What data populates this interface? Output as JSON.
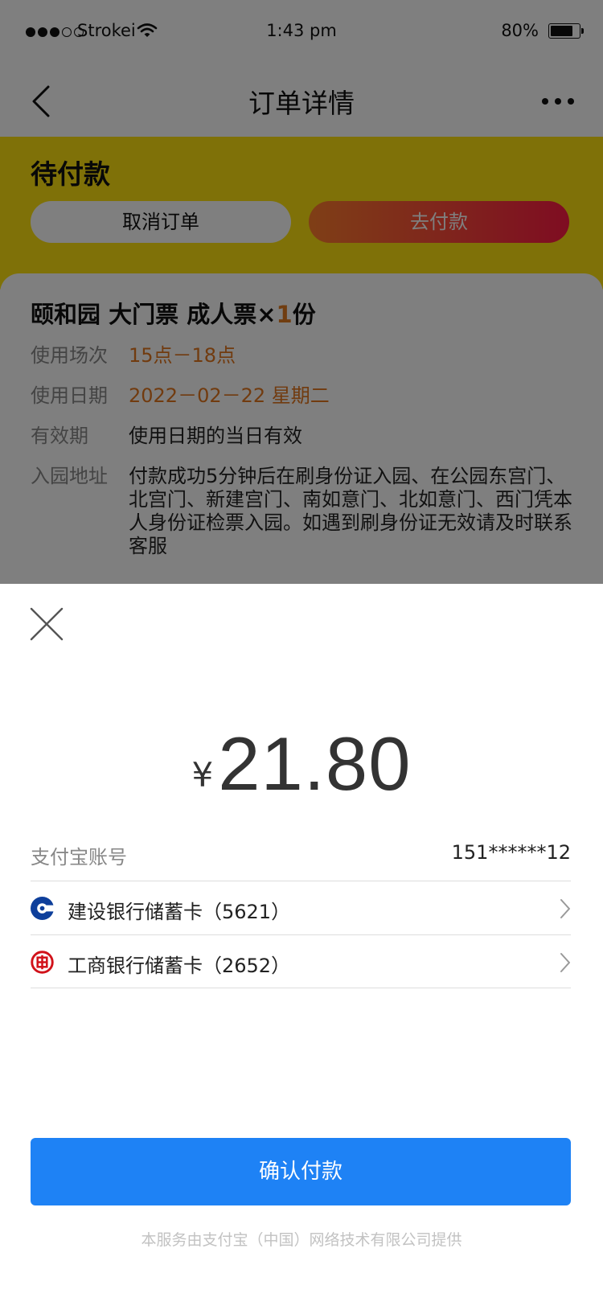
{
  "status_bar": {
    "carrier": "Strokei",
    "time": "1:43 pm",
    "battery": "80%",
    "battery_level": 0.8
  },
  "nav": {
    "title": "订单详情",
    "back_icon": "chevron-left-icon",
    "more_icon": "more-icon"
  },
  "order": {
    "status": "待付款",
    "cancel_label": "取消订单",
    "pay_label": "去付款",
    "ticket_name": "颐和园 大门票 成人票×",
    "ticket_qty": "1",
    "ticket_unit": "份",
    "details": [
      {
        "key": "使用场次",
        "value": "15点－18点",
        "highlight": true
      },
      {
        "key": "使用日期",
        "value": "2022－02－22 星期二",
        "highlight": true
      },
      {
        "key": "有效期",
        "value": "使用日期的当日有效",
        "highlight": false
      },
      {
        "key": "入园地址",
        "value": "付款成功5分钟后在刷身份证入园、在公园东宫门、北宫门、新建宫门、南如意门、北如意门、西门凭本人身份证检票入园。如遇到刷身份证无效请及时联系客服",
        "highlight": false
      }
    ]
  },
  "payment": {
    "currency": "¥",
    "amount": "21.80",
    "account_label": "支付宝账号",
    "account_value": "151******12",
    "banks": [
      {
        "name": "建设银行储蓄卡（5621）",
        "icon": "ccb-logo-icon",
        "color": "#0e3f9b"
      },
      {
        "name": "工商银行储蓄卡（2652）",
        "icon": "icbc-logo-icon",
        "color": "#d1121a"
      }
    ],
    "confirm_label": "确认付款",
    "footer": "本服务由支付宝（中国）网络技术有限公司提供"
  },
  "colors": {
    "banner": "#ffe311",
    "accent_orange": "#e2761f",
    "pay_gradient_start": "#ff7e2d",
    "pay_gradient_end": "#ff1a44",
    "confirm_blue": "#1e82f5"
  }
}
